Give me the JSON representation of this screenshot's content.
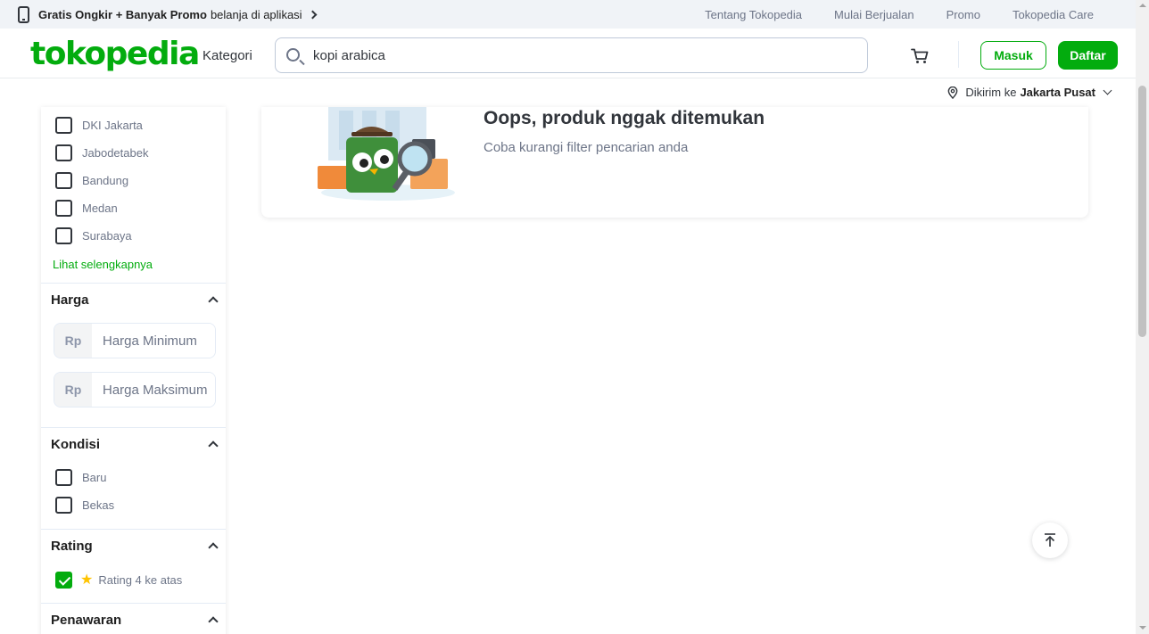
{
  "promo_bar": {
    "bold_text": "Gratis Ongkir + Banyak Promo",
    "rest_text": "belanja di aplikasi",
    "links": [
      "Tentang Tokopedia",
      "Mulai Berjualan",
      "Promo",
      "Tokopedia Care"
    ]
  },
  "header": {
    "logo": "tokopedia",
    "kategori": "Kategori",
    "search_value": "kopi arabica",
    "login_label": "Masuk",
    "register_label": "Daftar"
  },
  "location": {
    "prefix": "Dikirim ke",
    "city": "Jakarta Pusat"
  },
  "sidebar": {
    "locations": [
      "DKI Jakarta",
      "Jabodetabek",
      "Bandung",
      "Medan",
      "Surabaya"
    ],
    "see_more": "Lihat selengkapnya",
    "price": {
      "title": "Harga",
      "currency": "Rp",
      "min_placeholder": "Harga Minimum",
      "max_placeholder": "Harga Maksimum"
    },
    "condition": {
      "title": "Kondisi",
      "options": [
        "Baru",
        "Bekas"
      ]
    },
    "rating": {
      "title": "Rating",
      "option": "Rating 4 ke atas",
      "checked": true
    },
    "offer": {
      "title": "Penawaran"
    }
  },
  "empty_state": {
    "title": "Oops, produk nggak ditemukan",
    "subtitle": "Coba kurangi filter pencarian anda"
  },
  "colors": {
    "brand": "#03ac0e",
    "text": "#31353b",
    "muted": "#6d7588"
  }
}
